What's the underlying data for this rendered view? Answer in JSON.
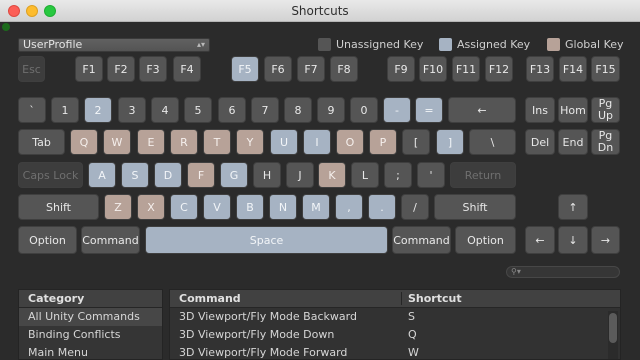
{
  "window": {
    "title": "Shortcuts"
  },
  "profile": {
    "selected": "UserProfile"
  },
  "legend": {
    "unassigned": {
      "label": "Unassigned Key",
      "color": "#555555"
    },
    "assigned": {
      "label": "Assigned Key",
      "color": "#a6b3c3"
    },
    "global": {
      "label": "Global Key",
      "color": "#b7a298"
    }
  },
  "keys": [
    {
      "id": "esc",
      "label": "Esc",
      "state": "dim"
    },
    {
      "id": "f1",
      "label": "F1",
      "state": "unassigned"
    },
    {
      "id": "f2",
      "label": "F2",
      "state": "unassigned"
    },
    {
      "id": "f3",
      "label": "F3",
      "state": "unassigned"
    },
    {
      "id": "f4",
      "label": "F4",
      "state": "unassigned"
    },
    {
      "id": "f5",
      "label": "F5",
      "state": "assigned"
    },
    {
      "id": "f6",
      "label": "F6",
      "state": "unassigned"
    },
    {
      "id": "f7",
      "label": "F7",
      "state": "unassigned"
    },
    {
      "id": "f8",
      "label": "F8",
      "state": "unassigned"
    },
    {
      "id": "f9",
      "label": "F9",
      "state": "unassigned"
    },
    {
      "id": "f10",
      "label": "F10",
      "state": "unassigned"
    },
    {
      "id": "f11",
      "label": "F11",
      "state": "unassigned"
    },
    {
      "id": "f12",
      "label": "F12",
      "state": "unassigned"
    },
    {
      "id": "f13",
      "label": "F13",
      "state": "unassigned"
    },
    {
      "id": "f14",
      "label": "F14",
      "state": "unassigned"
    },
    {
      "id": "f15",
      "label": "F15",
      "state": "unassigned"
    },
    {
      "id": "backquote",
      "label": "`",
      "state": "unassigned"
    },
    {
      "id": "1",
      "label": "1",
      "state": "unassigned"
    },
    {
      "id": "2",
      "label": "2",
      "state": "assigned"
    },
    {
      "id": "3",
      "label": "3",
      "state": "unassigned"
    },
    {
      "id": "4",
      "label": "4",
      "state": "unassigned"
    },
    {
      "id": "5",
      "label": "5",
      "state": "unassigned"
    },
    {
      "id": "6",
      "label": "6",
      "state": "unassigned"
    },
    {
      "id": "7",
      "label": "7",
      "state": "unassigned"
    },
    {
      "id": "8",
      "label": "8",
      "state": "unassigned"
    },
    {
      "id": "9",
      "label": "9",
      "state": "unassigned"
    },
    {
      "id": "0",
      "label": "0",
      "state": "unassigned"
    },
    {
      "id": "minus",
      "label": "-",
      "state": "assigned"
    },
    {
      "id": "equals",
      "label": "=",
      "state": "assigned"
    },
    {
      "id": "backspace",
      "label": "←",
      "state": "unassigned"
    },
    {
      "id": "ins",
      "label": "Ins",
      "state": "unassigned"
    },
    {
      "id": "home",
      "label": "Hom",
      "state": "unassigned"
    },
    {
      "id": "pgup",
      "label": "Pg\nUp",
      "state": "unassigned"
    },
    {
      "id": "tab",
      "label": "Tab",
      "state": "unassigned"
    },
    {
      "id": "q",
      "label": "Q",
      "state": "global"
    },
    {
      "id": "w",
      "label": "W",
      "state": "global"
    },
    {
      "id": "e",
      "label": "E",
      "state": "global"
    },
    {
      "id": "r",
      "label": "R",
      "state": "global"
    },
    {
      "id": "t",
      "label": "T",
      "state": "global"
    },
    {
      "id": "y",
      "label": "Y",
      "state": "global"
    },
    {
      "id": "u",
      "label": "U",
      "state": "assigned"
    },
    {
      "id": "i",
      "label": "I",
      "state": "assigned"
    },
    {
      "id": "o",
      "label": "O",
      "state": "global"
    },
    {
      "id": "p",
      "label": "P",
      "state": "global"
    },
    {
      "id": "lbracket",
      "label": "[",
      "state": "unassigned"
    },
    {
      "id": "rbracket",
      "label": "]",
      "state": "assigned"
    },
    {
      "id": "backslash",
      "label": "\\",
      "state": "unassigned"
    },
    {
      "id": "del",
      "label": "Del",
      "state": "unassigned"
    },
    {
      "id": "end",
      "label": "End",
      "state": "unassigned"
    },
    {
      "id": "pgdn",
      "label": "Pg\nDn",
      "state": "unassigned"
    },
    {
      "id": "capslock",
      "label": "Caps Lock",
      "state": "dim"
    },
    {
      "id": "a",
      "label": "A",
      "state": "assigned"
    },
    {
      "id": "s",
      "label": "S",
      "state": "assigned"
    },
    {
      "id": "d",
      "label": "D",
      "state": "assigned"
    },
    {
      "id": "f",
      "label": "F",
      "state": "global"
    },
    {
      "id": "g",
      "label": "G",
      "state": "assigned"
    },
    {
      "id": "h",
      "label": "H",
      "state": "unassigned"
    },
    {
      "id": "j",
      "label": "J",
      "state": "unassigned"
    },
    {
      "id": "k",
      "label": "K",
      "state": "global"
    },
    {
      "id": "l",
      "label": "L",
      "state": "unassigned"
    },
    {
      "id": "semicolon",
      "label": ";",
      "state": "unassigned"
    },
    {
      "id": "quote",
      "label": "'",
      "state": "unassigned"
    },
    {
      "id": "return",
      "label": "Return",
      "state": "dim"
    },
    {
      "id": "lshift",
      "label": "Shift",
      "state": "unassigned"
    },
    {
      "id": "z",
      "label": "Z",
      "state": "global"
    },
    {
      "id": "x",
      "label": "X",
      "state": "global"
    },
    {
      "id": "c",
      "label": "C",
      "state": "assigned"
    },
    {
      "id": "v",
      "label": "V",
      "state": "assigned"
    },
    {
      "id": "b",
      "label": "B",
      "state": "assigned"
    },
    {
      "id": "n",
      "label": "N",
      "state": "assigned"
    },
    {
      "id": "m",
      "label": "M",
      "state": "assigned"
    },
    {
      "id": "comma",
      "label": ",",
      "state": "assigned"
    },
    {
      "id": "period",
      "label": ".",
      "state": "assigned"
    },
    {
      "id": "slash",
      "label": "/",
      "state": "unassigned"
    },
    {
      "id": "rshift",
      "label": "Shift",
      "state": "unassigned"
    },
    {
      "id": "up",
      "label": "↑",
      "state": "unassigned"
    },
    {
      "id": "loption",
      "label": "Option",
      "state": "unassigned"
    },
    {
      "id": "lcommand",
      "label": "Command",
      "state": "unassigned"
    },
    {
      "id": "space",
      "label": "Space",
      "state": "assigned"
    },
    {
      "id": "rcommand",
      "label": "Command",
      "state": "unassigned"
    },
    {
      "id": "roption",
      "label": "Option",
      "state": "unassigned"
    },
    {
      "id": "left",
      "label": "←",
      "state": "unassigned"
    },
    {
      "id": "down",
      "label": "↓",
      "state": "unassigned"
    },
    {
      "id": "right",
      "label": "→",
      "state": "unassigned"
    }
  ],
  "search": {
    "placeholder": ""
  },
  "categories": {
    "header": "Category",
    "items": [
      {
        "label": "All Unity Commands",
        "selected": true
      },
      {
        "label": "Binding Conflicts",
        "selected": false
      },
      {
        "label": "Main Menu",
        "selected": false
      }
    ]
  },
  "commands": {
    "header_command": "Command",
    "header_shortcut": "Shortcut",
    "rows": [
      {
        "command": "3D Viewport/Fly Mode Backward",
        "shortcut": "S"
      },
      {
        "command": "3D Viewport/Fly Mode Down",
        "shortcut": "Q"
      },
      {
        "command": "3D Viewport/Fly Mode Forward",
        "shortcut": "W"
      }
    ]
  }
}
